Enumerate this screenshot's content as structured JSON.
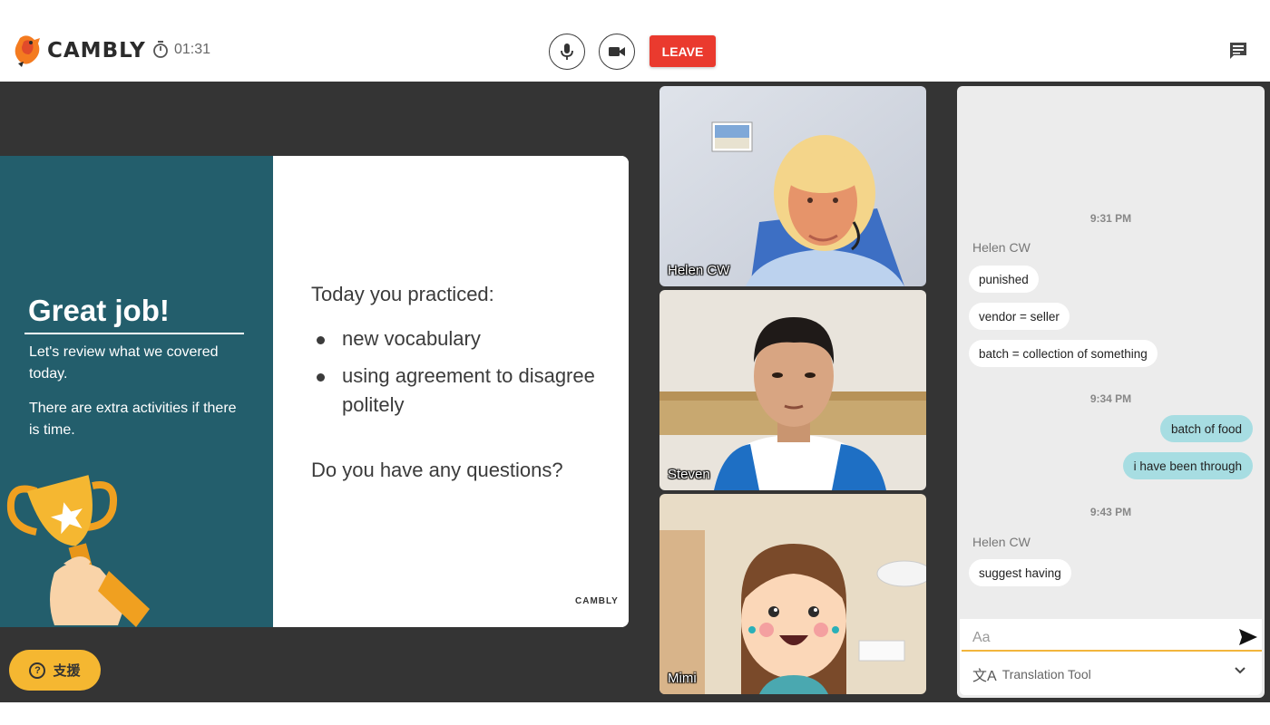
{
  "header": {
    "logo_text": "CAMBLY",
    "timer": "01:31",
    "leave_label": "LEAVE"
  },
  "slide": {
    "heading": "Great job!",
    "review_text": "Let's review what we covered today.",
    "extra_text": "There are extra activities if there is time.",
    "practiced_title": "Today you practiced:",
    "practiced_items": [
      "new vocabulary",
      "using agreement to disagree politely"
    ],
    "questions": "Do you have any questions?",
    "brand": "CAMBLY"
  },
  "help_button": {
    "label": "支援"
  },
  "participants": [
    {
      "name": "Helen CW"
    },
    {
      "name": "Steven"
    },
    {
      "name": "Mimi"
    }
  ],
  "chat": {
    "timestamps": [
      "9:31 PM",
      "9:34 PM",
      "9:43 PM"
    ],
    "messages": [
      {
        "sender": "Helen CW",
        "text": "punished"
      },
      {
        "text": "vendor = seller"
      },
      {
        "text": "batch = collection of something"
      },
      {
        "text": "batch of food"
      },
      {
        "text": "i have been through"
      },
      {
        "sender": "Helen CW",
        "text": "suggest having"
      }
    ],
    "input_placeholder": "Aa",
    "translation_tool_label": "Translation Tool"
  },
  "colors": {
    "leave": "#ea3a2e",
    "slide_panel": "#235e6c",
    "help": "#f5b731",
    "own_bubble": "#a7dde2",
    "input_underline": "#f2b63c"
  },
  "icons": [
    "cambly-bird-icon",
    "stopwatch-icon",
    "microphone-icon",
    "video-camera-icon",
    "chat-icon",
    "trophy-icon",
    "help-icon",
    "send-icon",
    "translate-icon",
    "chevron-down-icon"
  ]
}
